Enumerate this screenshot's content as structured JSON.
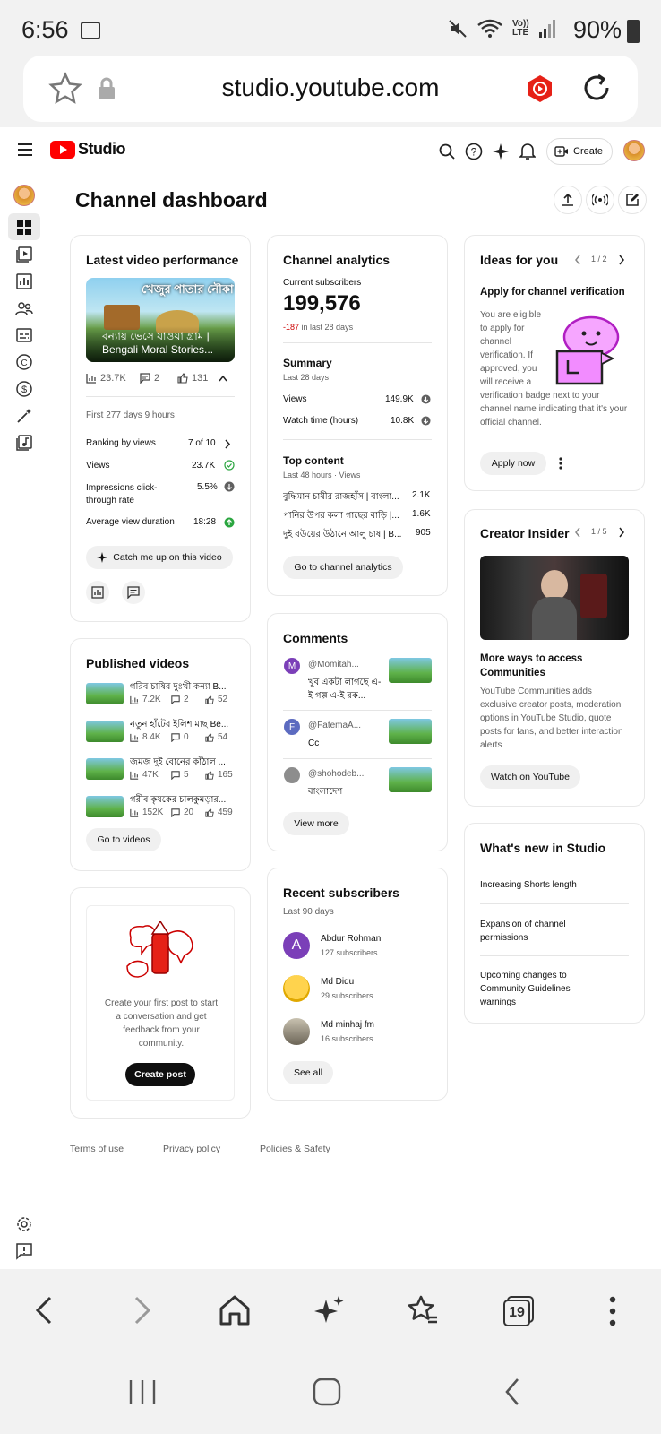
{
  "status": {
    "time": "6:56",
    "battery": "90%"
  },
  "browser": {
    "url": "studio.youtube.com",
    "tabs_count": "19"
  },
  "header": {
    "logo_text": "Studio",
    "create_label": "Create"
  },
  "page_title": "Channel dashboard",
  "latest_video": {
    "title": "Latest video performance",
    "video_title": "বন্যায় ভেসে যাওয়া গ্রাম | Bengali Moral Stories...",
    "thumb_text": "খেজুর পাতার নৌকা",
    "views": "23.7K",
    "comments": "2",
    "likes": "131",
    "period": "First 277 days 9 hours",
    "rows": [
      {
        "label": "Ranking by views",
        "value": "7 of 10"
      },
      {
        "label": "Views",
        "value": "23.7K"
      },
      {
        "label": "Impressions click-through rate",
        "value": "5.5%"
      },
      {
        "label": "Average view duration",
        "value": "18:28"
      }
    ],
    "catch_up": "Catch me up on this video"
  },
  "published": {
    "title": "Published videos",
    "items": [
      {
        "title": "গরিব চাষির দুঃখী কন্যা B...",
        "views": "7.2K",
        "comments": "2",
        "likes": "52"
      },
      {
        "title": "নতুন হাঁটের ইলিশ মাছ Be...",
        "views": "8.4K",
        "comments": "0",
        "likes": "54"
      },
      {
        "title": "জমজ দুই বোনের কাঁঠাল ...",
        "views": "47K",
        "comments": "5",
        "likes": "165"
      },
      {
        "title": "গরীব কৃষকের চালকুমড়ার...",
        "views": "152K",
        "comments": "20",
        "likes": "459"
      }
    ],
    "button": "Go to videos"
  },
  "create_post": {
    "text": "Create your first post to start a conversation and get feedback from your community.",
    "button": "Create post"
  },
  "analytics": {
    "title": "Channel analytics",
    "subs_label": "Current subscribers",
    "subs_value": "199,576",
    "subs_change": "-187",
    "subs_change_suffix": "in last 28 days",
    "summary_title": "Summary",
    "summary_period": "Last 28 days",
    "rows": [
      {
        "label": "Views",
        "value": "149.9K"
      },
      {
        "label": "Watch time (hours)",
        "value": "10.8K"
      }
    ],
    "top_title": "Top content",
    "top_period": "Last 48 hours · Views",
    "top": [
      {
        "title": "বুদ্ধিমান চাষীর রাজহাঁস | বাংলা...",
        "value": "2.1K"
      },
      {
        "title": "পানির উপর কলা গাছের বাড়ি |...",
        "value": "1.6K"
      },
      {
        "title": "দুই বউয়ের উঠানে আলু চাষ | B...",
        "value": "905"
      }
    ],
    "button": "Go to channel analytics"
  },
  "comments": {
    "title": "Comments",
    "items": [
      {
        "avatar": "M",
        "user": "@Momitah...",
        "text": "খুব একটা লাগছে এ-ই গল্প এ-ই রক...",
        "color": "#7b3fb8"
      },
      {
        "avatar": "F",
        "user": "@FatemaA...",
        "text": "Cc",
        "color": "#5c6bc0"
      },
      {
        "avatar": "",
        "user": "@shohodeb...",
        "text": "বাংলাদেশ",
        "color": "#8d8d8d"
      }
    ],
    "button": "View more"
  },
  "recent_subs": {
    "title": "Recent subscribers",
    "period": "Last 90 days",
    "items": [
      {
        "name": "Abdur Rohman",
        "count": "127 subscribers",
        "avatar": "A"
      },
      {
        "name": "Md Didu",
        "count": "29 subscribers",
        "avatar": ""
      },
      {
        "name": "Md minhaj fm",
        "count": "16 subscribers",
        "avatar": ""
      }
    ],
    "button": "See all"
  },
  "ideas": {
    "title": "Ideas for you",
    "pager": "1 / 2",
    "heading": "Apply for channel verification",
    "body": "You are eligible to apply for channel verification. If approved, you will receive a verification badge next to your channel name indicating that it's your official channel.",
    "button": "Apply now"
  },
  "insider": {
    "title": "Creator Insider",
    "pager": "1 / 5",
    "heading": "More ways to access Communities",
    "body": "YouTube Communities adds exclusive creator posts, moderation options in YouTube Studio, quote posts for fans, and better interaction alerts",
    "button": "Watch on YouTube"
  },
  "whats_new": {
    "title": "What's new in Studio",
    "items": [
      "Increasing Shorts length",
      "Expansion of channel permissions",
      "Upcoming changes to Community Guidelines warnings"
    ]
  },
  "footer": {
    "terms": "Terms of use",
    "privacy": "Privacy policy",
    "policies": "Policies & Safety"
  },
  "colors": {
    "youtube_red": "#ff0000",
    "accent": "#065fd4",
    "status_green": "#2ba640"
  }
}
